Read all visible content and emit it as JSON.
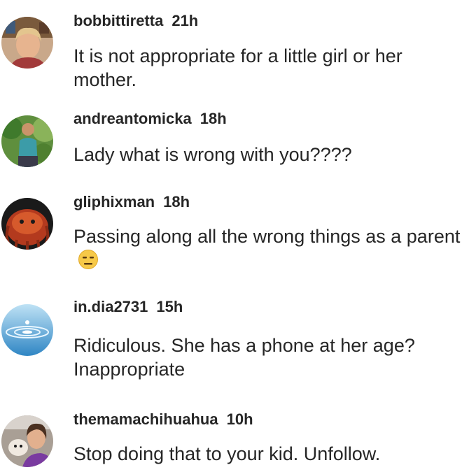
{
  "comments": [
    {
      "username": "bobbittiretta",
      "time": "21h",
      "text": "It is not  appropriate for a little girl or her mother.",
      "avatar": "woman-portrait-avatar"
    },
    {
      "username": "andreantomicka",
      "time": "18h",
      "text": "Lady what is wrong with you????",
      "avatar": "person-outdoors-avatar"
    },
    {
      "username": "gliphixman",
      "time": "18h",
      "text": "Passing along all the wrong things as a parent",
      "emoji": "expressionless-face-emoji",
      "avatar": "red-creature-avatar"
    },
    {
      "username": "in.dia2731",
      "time": "15h",
      "text": "Ridiculous. She has a phone at her age? Inappropriate",
      "avatar": "water-droplet-avatar"
    },
    {
      "username": "themamachihuahua",
      "time": "10h",
      "text": "Stop doing that to your kid. Unfollow.",
      "avatar": "woman-with-dog-avatar"
    }
  ]
}
